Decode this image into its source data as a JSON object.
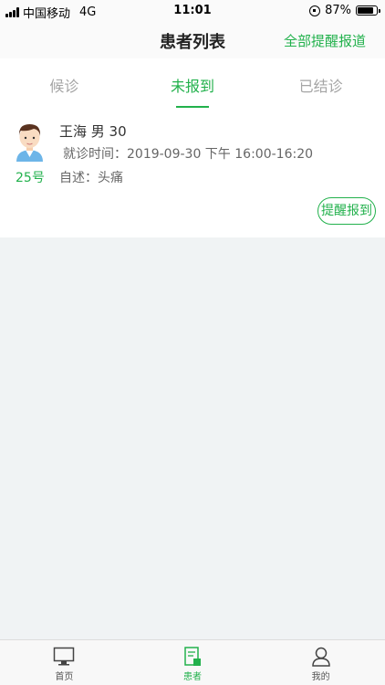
{
  "status_bar": {
    "carrier": "中国移动",
    "network": "4G",
    "time": "11:01",
    "battery": "87%",
    "battery_level": 0.87
  },
  "header": {
    "title": "患者列表",
    "action_label": "全部提醒报道"
  },
  "tabs": [
    {
      "label": "候诊",
      "active": false
    },
    {
      "label": "未报到",
      "active": true
    },
    {
      "label": "已结诊",
      "active": false
    }
  ],
  "patients": [
    {
      "name_line": "王海 男 30",
      "visit_time": "就诊时间：2019-09-30 下午 16:00-16:20",
      "complaint": "自述：头痛",
      "queue_number": "25号",
      "remind_label": "提醒报到"
    }
  ],
  "tab_bar": {
    "items": [
      {
        "label": "首页",
        "icon": "monitor-icon",
        "active": false
      },
      {
        "label": "患者",
        "icon": "patient-record-icon",
        "active": true
      },
      {
        "label": "我的",
        "icon": "person-icon",
        "active": false
      }
    ]
  },
  "colors": {
    "accent": "#22b14c",
    "background": "#f0f3f4"
  }
}
